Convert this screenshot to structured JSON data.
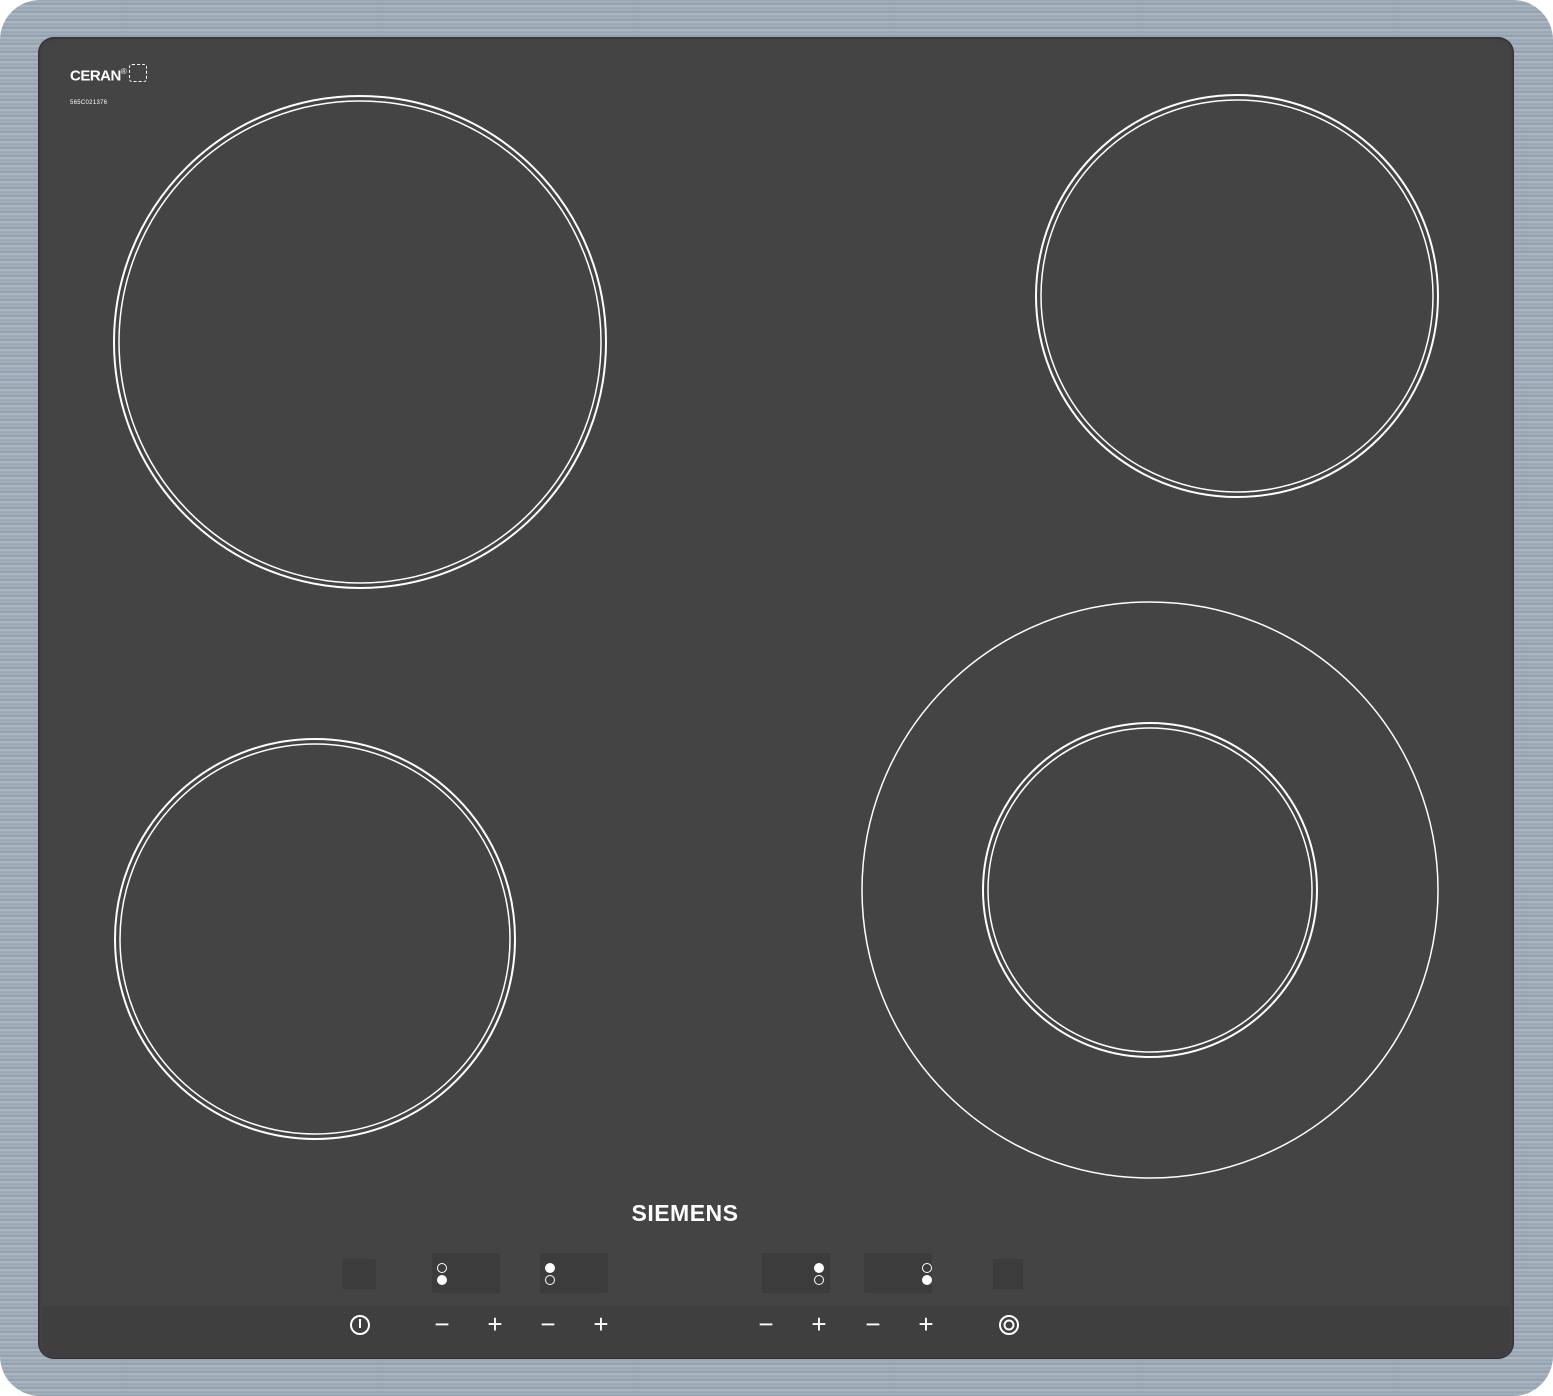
{
  "branding": {
    "ceran_label": "CERAN",
    "ceran_reg": "®",
    "ceran_code": "565C021376",
    "manufacturer": "SIEMENS"
  },
  "cooking_zones": [
    {
      "id": "rear-left",
      "type": "single"
    },
    {
      "id": "rear-right",
      "type": "single"
    },
    {
      "id": "front-left",
      "type": "single"
    },
    {
      "id": "front-right",
      "type": "dual"
    }
  ],
  "controls": {
    "power_icon": "power-icon",
    "keys": [
      {
        "id": "zone1-minus",
        "label": "−"
      },
      {
        "id": "zone1-plus",
        "label": "+"
      },
      {
        "id": "zone2-minus",
        "label": "−"
      },
      {
        "id": "zone2-plus",
        "label": "+"
      },
      {
        "id": "zone3-minus",
        "label": "−"
      },
      {
        "id": "zone3-plus",
        "label": "+"
      },
      {
        "id": "zone4-minus",
        "label": "−"
      },
      {
        "id": "zone4-plus",
        "label": "+"
      }
    ],
    "dual_zone_icon": "dual-circuit-icon",
    "zone_indicators": [
      {
        "zone": "front-left",
        "top": "off",
        "bottom": "on"
      },
      {
        "zone": "rear-left",
        "top": "on",
        "bottom": "off"
      },
      {
        "zone": "rear-right",
        "top": "on",
        "bottom": "off"
      },
      {
        "zone": "front-right",
        "top": "off",
        "bottom": "on"
      }
    ]
  },
  "colors": {
    "glass": "#444444",
    "frame": "#9aa6b2",
    "markings": "#ffffff"
  }
}
